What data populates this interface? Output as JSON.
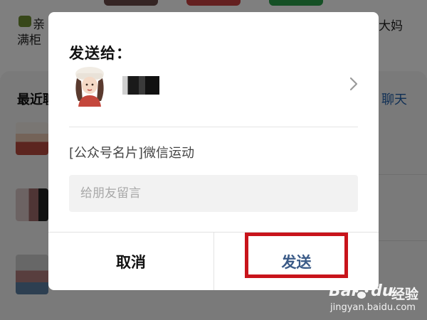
{
  "background": {
    "top_labels": [
      "亲",
      "满柜",
      "大妈"
    ],
    "section_title": "最近聊",
    "chat_link": "聊天"
  },
  "dialog": {
    "title": "发送给：",
    "recipient": {
      "name": "",
      "avatar_icon": "user-avatar-girl-white-hat",
      "chevron_icon": "chevron-right-icon"
    },
    "card_text": "[公众号名片]微信运动",
    "message_placeholder": "给朋友留言",
    "cancel_label": "取消",
    "send_label": "发送"
  },
  "annotation": {
    "highlight_color": "#c8141b",
    "target": "send-button"
  },
  "watermark": {
    "brand": "Bai",
    "brand_suffix": "du",
    "brand_cn": "经验",
    "url": "jingyan.baidu.com"
  },
  "colors": {
    "send": "#3a5a87",
    "overlay": "rgba(0,0,0,0.5)",
    "chat_link": "#1f5faa"
  }
}
